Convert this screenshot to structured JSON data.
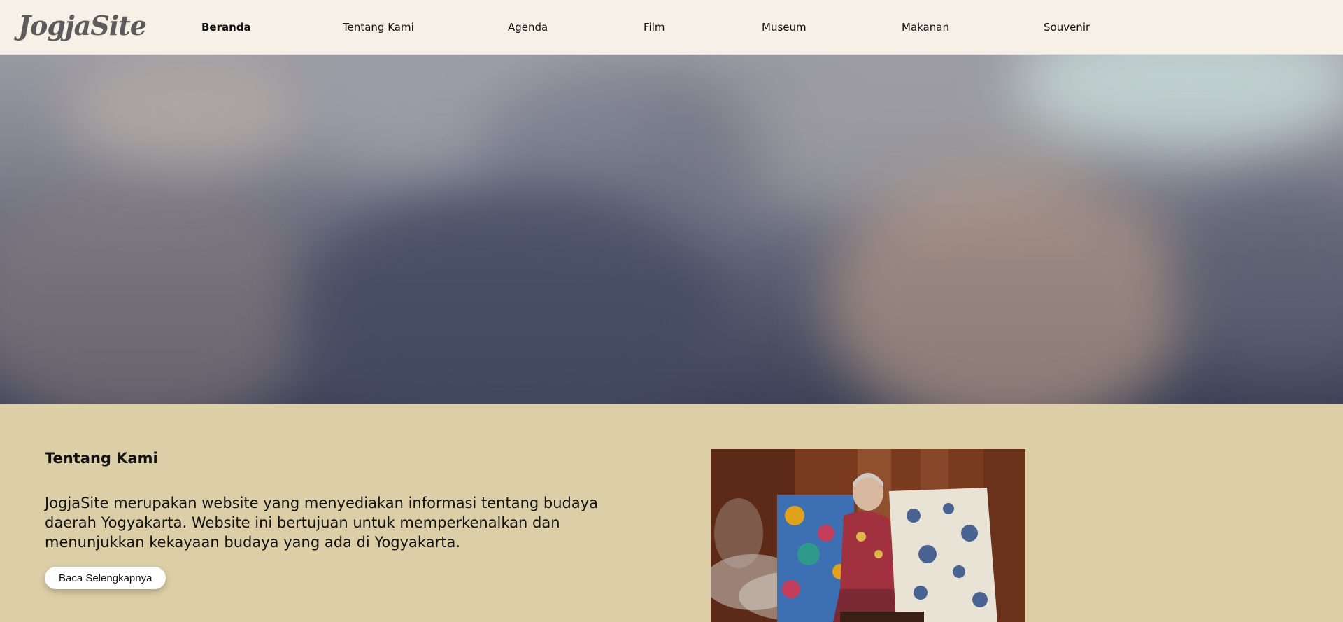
{
  "header": {
    "logo_text": "JogjaSite",
    "nav": [
      {
        "label": "Beranda",
        "active": true
      },
      {
        "label": "Tentang Kami",
        "active": false
      },
      {
        "label": "Agenda",
        "active": false
      },
      {
        "label": "Film",
        "active": false
      },
      {
        "label": "Museum",
        "active": false
      },
      {
        "label": "Makanan",
        "active": false
      },
      {
        "label": "Souvenir",
        "active": false
      }
    ]
  },
  "about": {
    "title": "Tentang Kami",
    "text": "JogjaSite merupakan website yang menyediakan informasi tentang budaya daerah Yogyakarta. Website ini bertujuan untuk memperkenalkan dan menunjukkan kekayaan budaya yang ada di Yogyakarta.",
    "button_label": "Baca Selengkapnya"
  },
  "colors": {
    "header_bg": "#f6f0e6",
    "section_bg": "#dccfa8",
    "button_bg": "#ffffff"
  }
}
